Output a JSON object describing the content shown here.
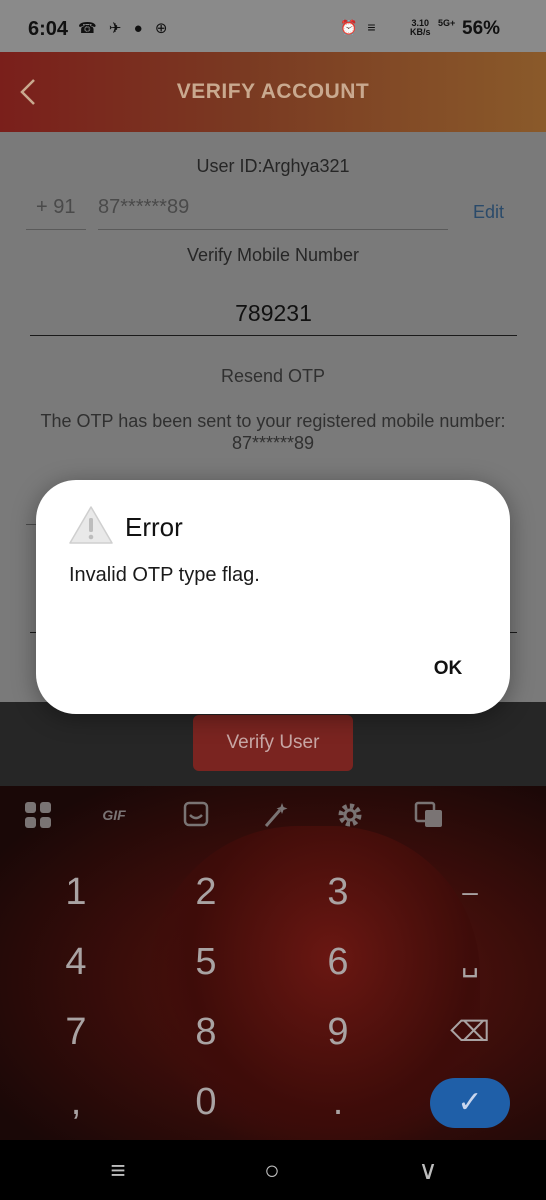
{
  "status_bar": {
    "time": "6:04",
    "left_icons": "☎ ✈ ● ⊕",
    "right_icons": "⏰ ≡",
    "net_line1": "3.10",
    "net_line2": "KB/s",
    "signal": "5G+",
    "battery": "56%"
  },
  "header": {
    "title": "VERIFY ACCOUNT",
    "back_icon": "chevron-left-icon"
  },
  "form": {
    "user_id": "User ID:Arghya321",
    "country_code": "+ 91",
    "phone_masked": "87******89",
    "edit_label": "Edit",
    "verify_label": "Verify Mobile Number",
    "otp_value": "789231",
    "resend_label": "Resend OTP",
    "otp_note_line1": "The OTP has been sent to your registered mobile number:",
    "otp_note_line2": "87******89"
  },
  "verify_button": {
    "label": "Verify User"
  },
  "dialog": {
    "title": "Error",
    "message": "Invalid OTP type flag.",
    "ok_label": "OK",
    "icon": "warning-triangle-icon"
  },
  "keyboard": {
    "toolbar": [
      "apps-grid-icon",
      "gif-icon",
      "sticker-icon",
      "magic-wand-icon",
      "gear-icon",
      "translate-icon"
    ],
    "gif_label": "GIF",
    "keys": {
      "k1": "1",
      "k2": "2",
      "k3": "3",
      "minus": "–",
      "k4": "4",
      "k5": "5",
      "k6": "6",
      "space": "␣",
      "k7": "7",
      "k8": "8",
      "k9": "9",
      "backspace": "⌫",
      "comma": ",",
      "k0": "0",
      "period": ".",
      "enter": "✓"
    }
  },
  "nav_bar": {
    "menu": "≡",
    "home": "○",
    "back": "∨"
  }
}
